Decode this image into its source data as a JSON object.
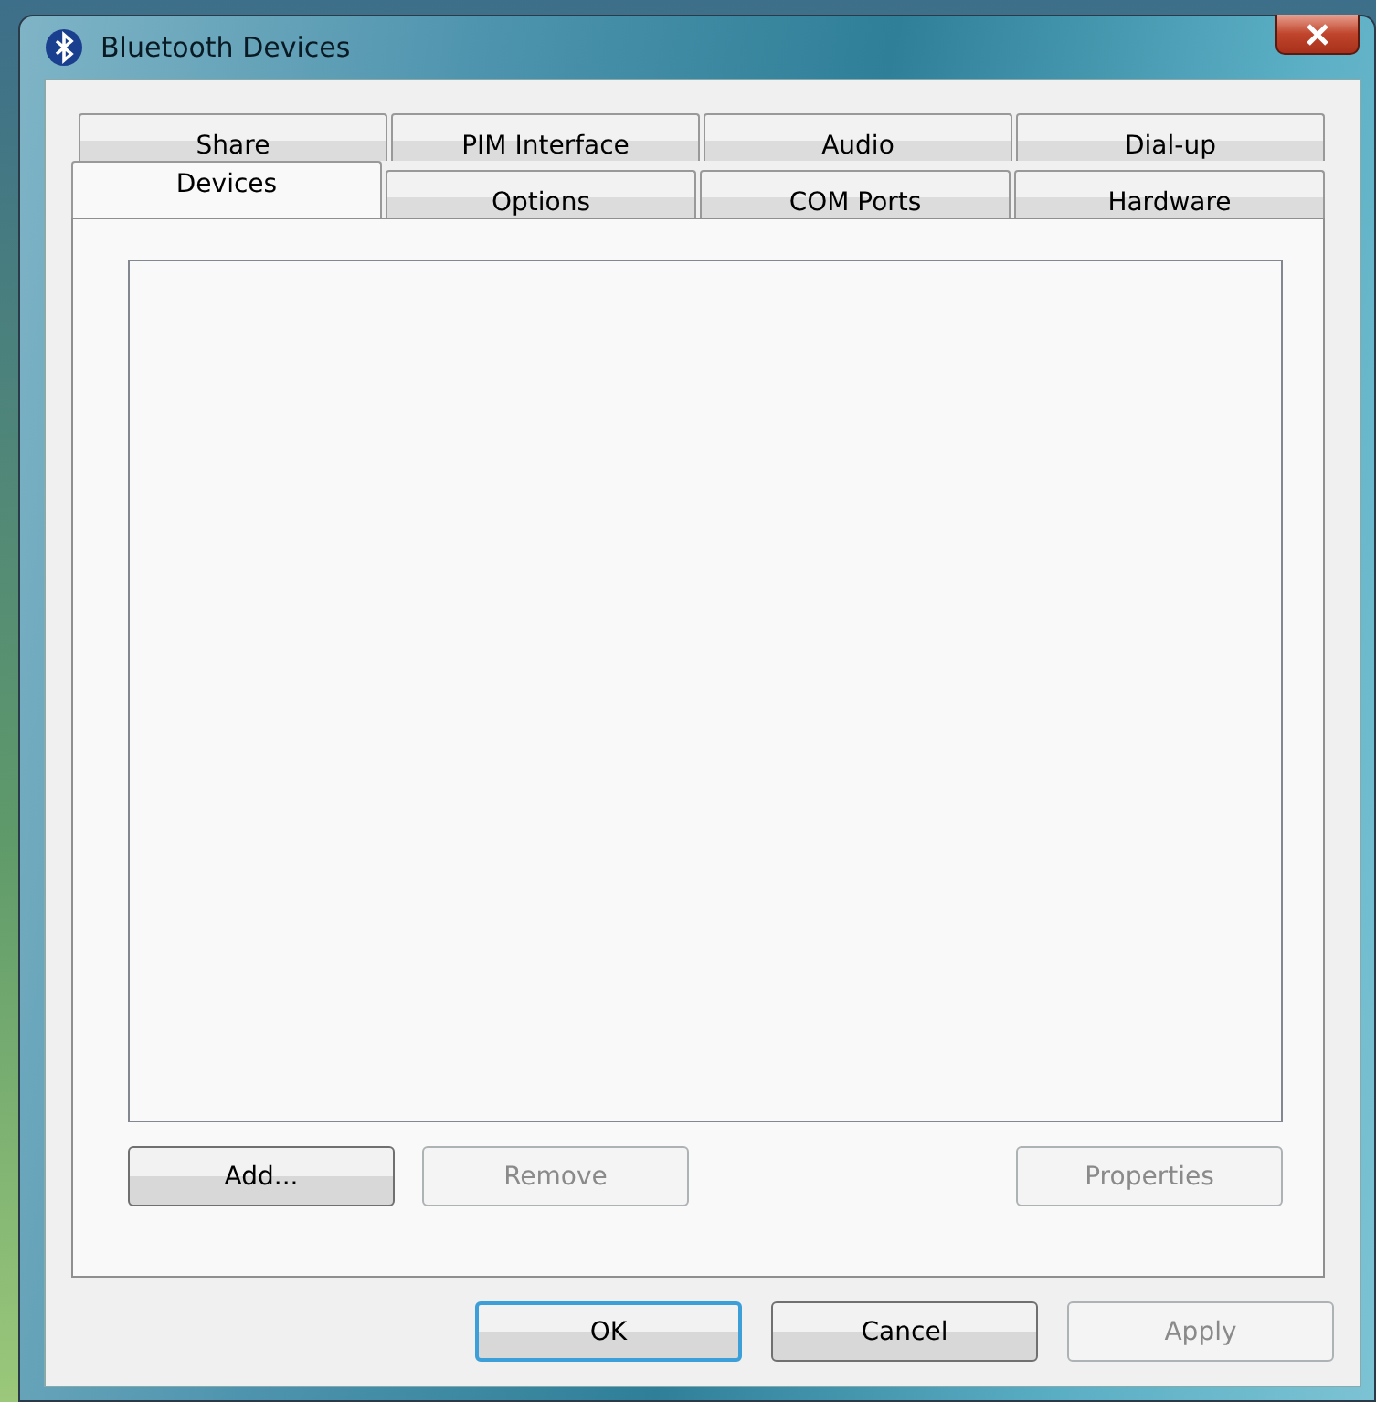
{
  "window": {
    "title": "Bluetooth Devices"
  },
  "tab_rows": [
    [
      {
        "label": "Share",
        "selected": false
      },
      {
        "label": "PIM Interface",
        "selected": false
      },
      {
        "label": "Audio",
        "selected": false
      },
      {
        "label": "Dial-up",
        "selected": false
      }
    ],
    [
      {
        "label": "Devices",
        "selected": true
      },
      {
        "label": "Options",
        "selected": false
      },
      {
        "label": "COM Ports",
        "selected": false
      },
      {
        "label": "Hardware",
        "selected": false
      }
    ]
  ],
  "device_buttons": [
    {
      "label": "Add...",
      "disabled": false,
      "default": false
    },
    {
      "label": "Remove",
      "disabled": true,
      "default": false
    },
    {
      "label": "Properties",
      "disabled": true,
      "default": false
    }
  ],
  "dialog_buttons": [
    {
      "label": "OK",
      "disabled": false,
      "default": true
    },
    {
      "label": "Cancel",
      "disabled": false,
      "default": false
    },
    {
      "label": "Apply",
      "disabled": true,
      "default": false
    }
  ]
}
